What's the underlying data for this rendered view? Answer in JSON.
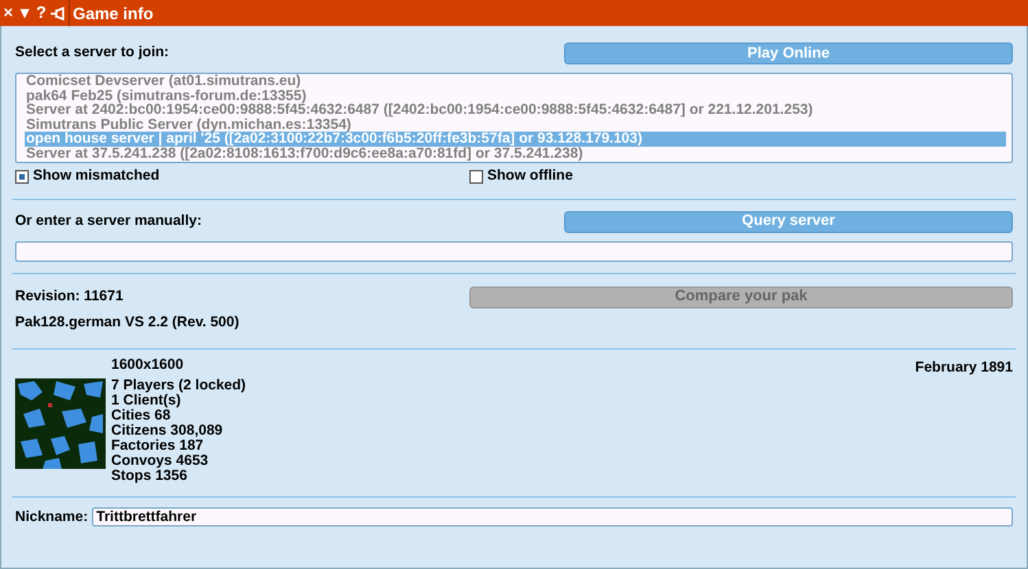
{
  "window": {
    "title": "Game info",
    "title_buttons": [
      "×",
      "▾",
      "?"
    ]
  },
  "server_select": {
    "label": "Select a server to join:",
    "button": {
      "label": "Play Online",
      "disabled": false
    },
    "servers": [
      {
        "label": "Comicset Devserver (at01.simutrans.eu)",
        "selected": false
      },
      {
        "label": "pak64 Feb25 (simutrans-forum.de:13355)",
        "selected": false
      },
      {
        "label": "Server at 2402:bc00:1954:ce00:9888:5f45:4632:6487 ([2402:bc00:1954:ce00:9888:5f45:4632:6487] or 221.12.201.253)",
        "selected": false
      },
      {
        "label": "Simutrans Public Server (dyn.michan.es:13354)",
        "selected": false
      },
      {
        "label": "open house server | april '25 ([2a02:3100:22b7:3c00:f6b5:20ff:fe3b:57fa] or 93.128.179.103)",
        "selected": true
      },
      {
        "label": "Server at 37.5.241.238 ([2a02:8108:1613:f700:d9c6:ee8a:a70:81fd] or 37.5.241.238)",
        "selected": false
      }
    ],
    "options": [
      {
        "label": "Show mismatched",
        "checked": true
      },
      {
        "label": "Show offline",
        "checked": false
      }
    ]
  },
  "manual": {
    "label": "Or enter a server manually:",
    "button": {
      "label": "Query server",
      "disabled": false
    }
  },
  "version": {
    "revision": "Revision: 11671",
    "pak": "Pak128.german VS 2.2 (Rev. 500)",
    "button": {
      "label": "Compare your pak",
      "disabled": true
    }
  },
  "game": {
    "size": "1600x1600",
    "date": "February 1891",
    "stats": [
      "7 Players (2 locked)",
      "1 Client(s)",
      "Cities 68",
      "Citizens 308,089",
      "Factories 187",
      "Convoys 4653",
      "Stops 1356"
    ]
  },
  "nickname": {
    "label": "Nickname:",
    "value": "Trittbrettfahrer"
  }
}
